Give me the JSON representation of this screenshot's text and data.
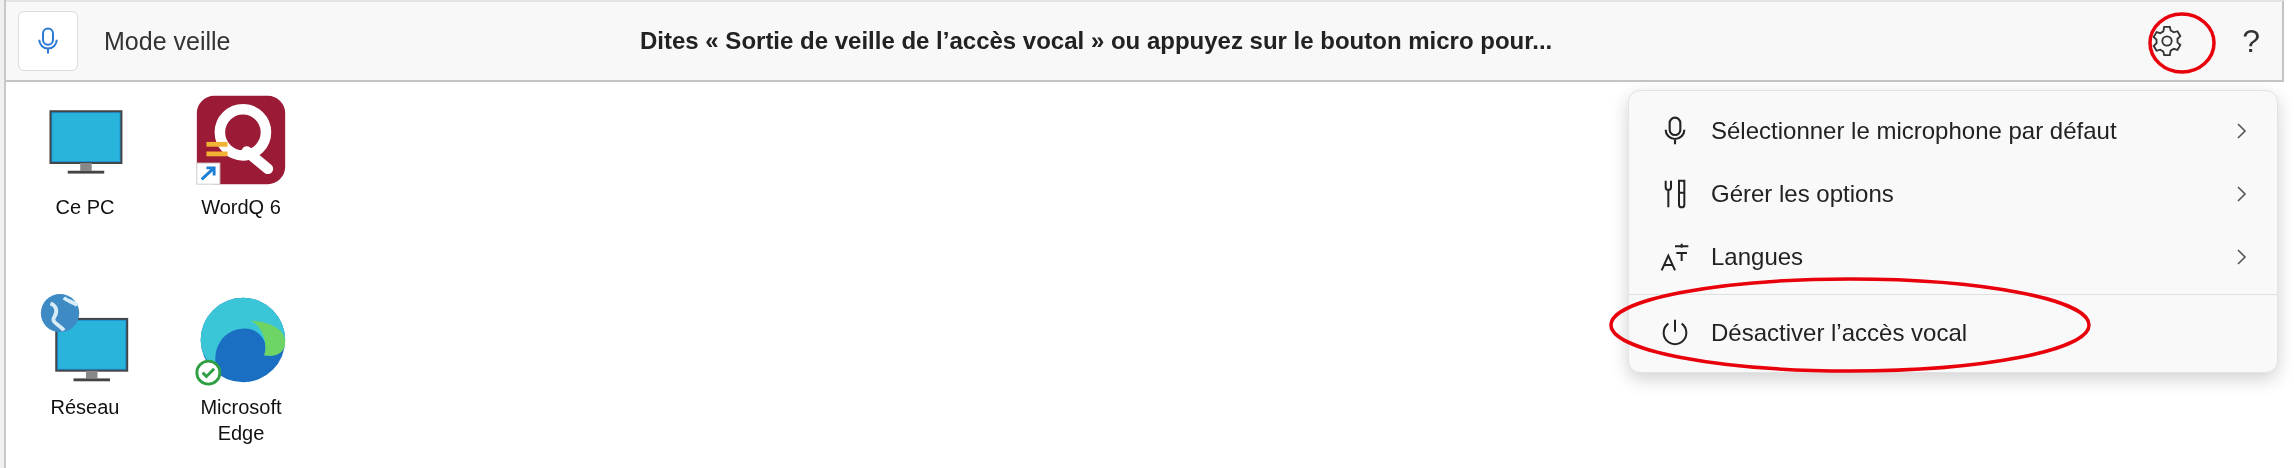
{
  "voice_bar": {
    "status": "Mode veille",
    "message": "Dites « Sortie de veille de l’accès vocal » ou appuyez sur le bouton micro pour...",
    "help": "?"
  },
  "menu": {
    "items": [
      {
        "kind": "microphone",
        "label": "Sélectionner le microphone par défaut",
        "has_submenu": true,
        "separator_before": false
      },
      {
        "kind": "options",
        "label": "Gérer les options",
        "has_submenu": true,
        "separator_before": false
      },
      {
        "kind": "language",
        "label": "Langues",
        "has_submenu": true,
        "separator_before": false
      },
      {
        "kind": "power",
        "label": "Désactiver l’accès vocal",
        "has_submenu": false,
        "separator_before": true
      }
    ]
  },
  "desktop_icons": [
    {
      "kind": "computer",
      "label": "Ce PC"
    },
    {
      "kind": "app",
      "label": "WordQ 6"
    },
    {
      "kind": "network",
      "label": "Réseau"
    },
    {
      "kind": "browser",
      "label": "Microsoft Edge"
    }
  ]
}
